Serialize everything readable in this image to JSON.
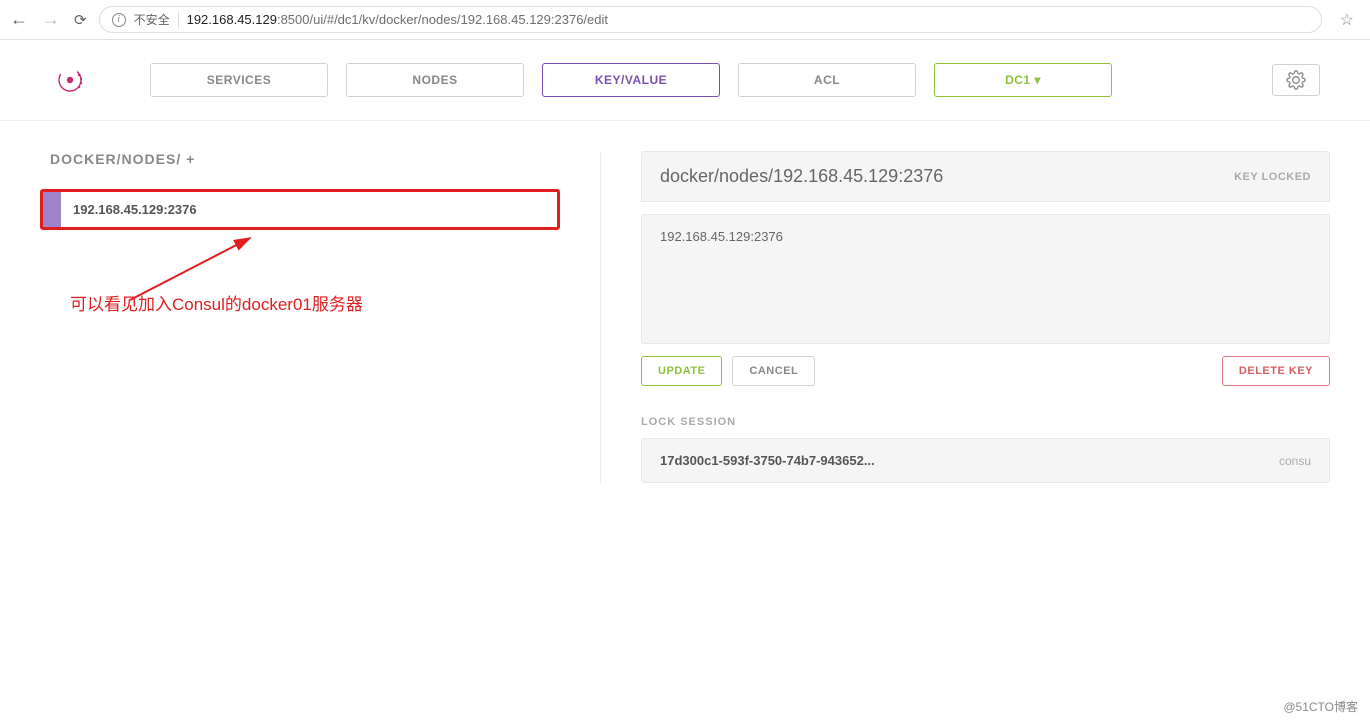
{
  "browser": {
    "insecure_label": "不安全",
    "url_host": "192.168.45.129",
    "url_port_path": ":8500/ui/#/dc1/kv/docker/nodes/192.168.45.129:2376/edit"
  },
  "nav": {
    "services": "SERVICES",
    "nodes": "NODES",
    "keyvalue": "KEY/VALUE",
    "acl": "ACL",
    "dc": "DC1 ▾"
  },
  "breadcrumb": "DOCKER/NODES/ +",
  "key_item": "192.168.45.129:2376",
  "annotation": "可以看见加入Consul的docker01服务器",
  "editor": {
    "title": "docker/nodes/192.168.45.129:2376",
    "locked": "KEY LOCKED",
    "value": "192.168.45.129:2376",
    "update": "UPDATE",
    "cancel": "CANCEL",
    "delete": "DELETE KEY"
  },
  "lock": {
    "label": "LOCK SESSION",
    "session_id": "17d300c1-593f-3750-74b7-943652...",
    "session_name": "consu"
  },
  "watermark": "@51CTO博客"
}
